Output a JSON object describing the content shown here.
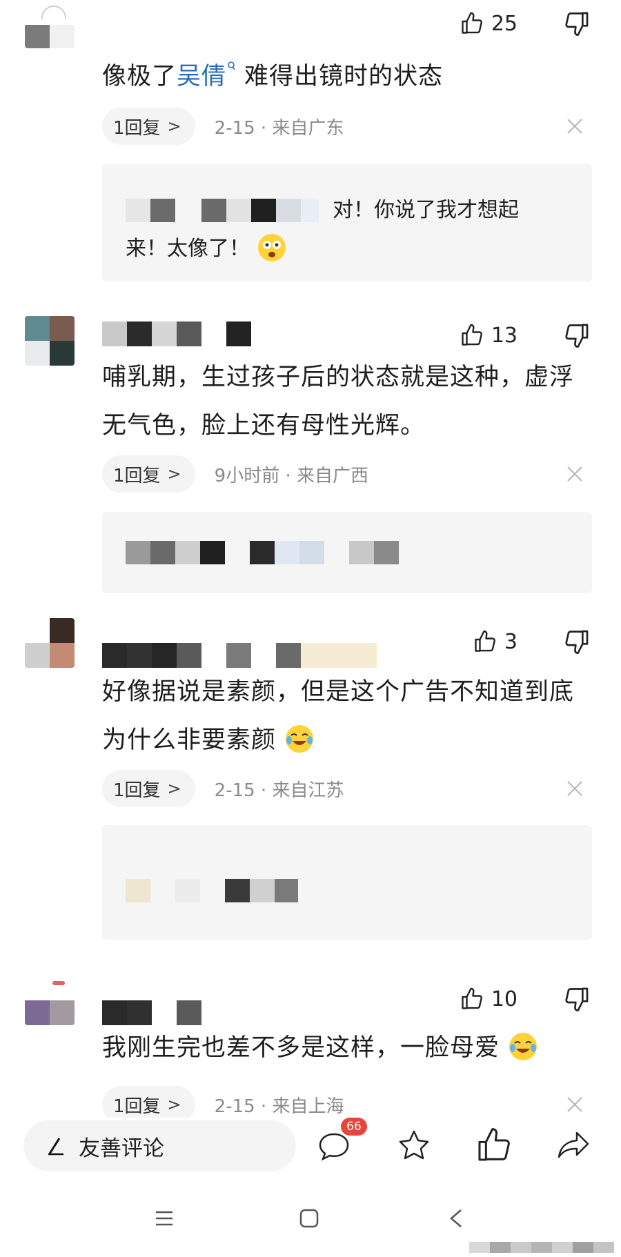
{
  "comments": [
    {
      "likes": "25",
      "text_parts": {
        "before": "像极了",
        "link": "吴倩",
        "after": "难得出镜时的状态"
      },
      "reply_count": "1回复",
      "date": "2-15 · 来自广东",
      "reply": {
        "text_line1": "对！你说了我才想起",
        "text_line2": "来！太像了！"
      }
    },
    {
      "likes": "13",
      "text": "哺乳期，生过孩子后的状态就是这种，虚浮无气色，脸上还有母性光辉。",
      "reply_count": "1回复",
      "date": "9小时前 · 来自广西"
    },
    {
      "likes": "3",
      "text": "好像据说是素颜，但是这个广告不知道到底为什么非要素颜",
      "reply_count": "1回复",
      "date": "2-15 · 来自江苏"
    },
    {
      "likes": "10",
      "text": "我刚生完也差不多是这样，一脸母爱",
      "reply_count": "1回复",
      "date": "2-15 · 来自上海"
    }
  ],
  "bottom_bar": {
    "input_label": "友善评论",
    "comment_count_badge": "66",
    "icons": [
      "pen-icon",
      "comment-icon",
      "star-icon",
      "thumbs-up-icon",
      "share-icon"
    ]
  },
  "nav": {
    "icons": [
      "menu-icon",
      "home-icon",
      "back-icon"
    ]
  },
  "colors": {
    "link": "#2a6bb8",
    "badge": "#e8453c",
    "reply_bg": "#f5f5f5",
    "pill_bg": "#f4f4f4"
  }
}
